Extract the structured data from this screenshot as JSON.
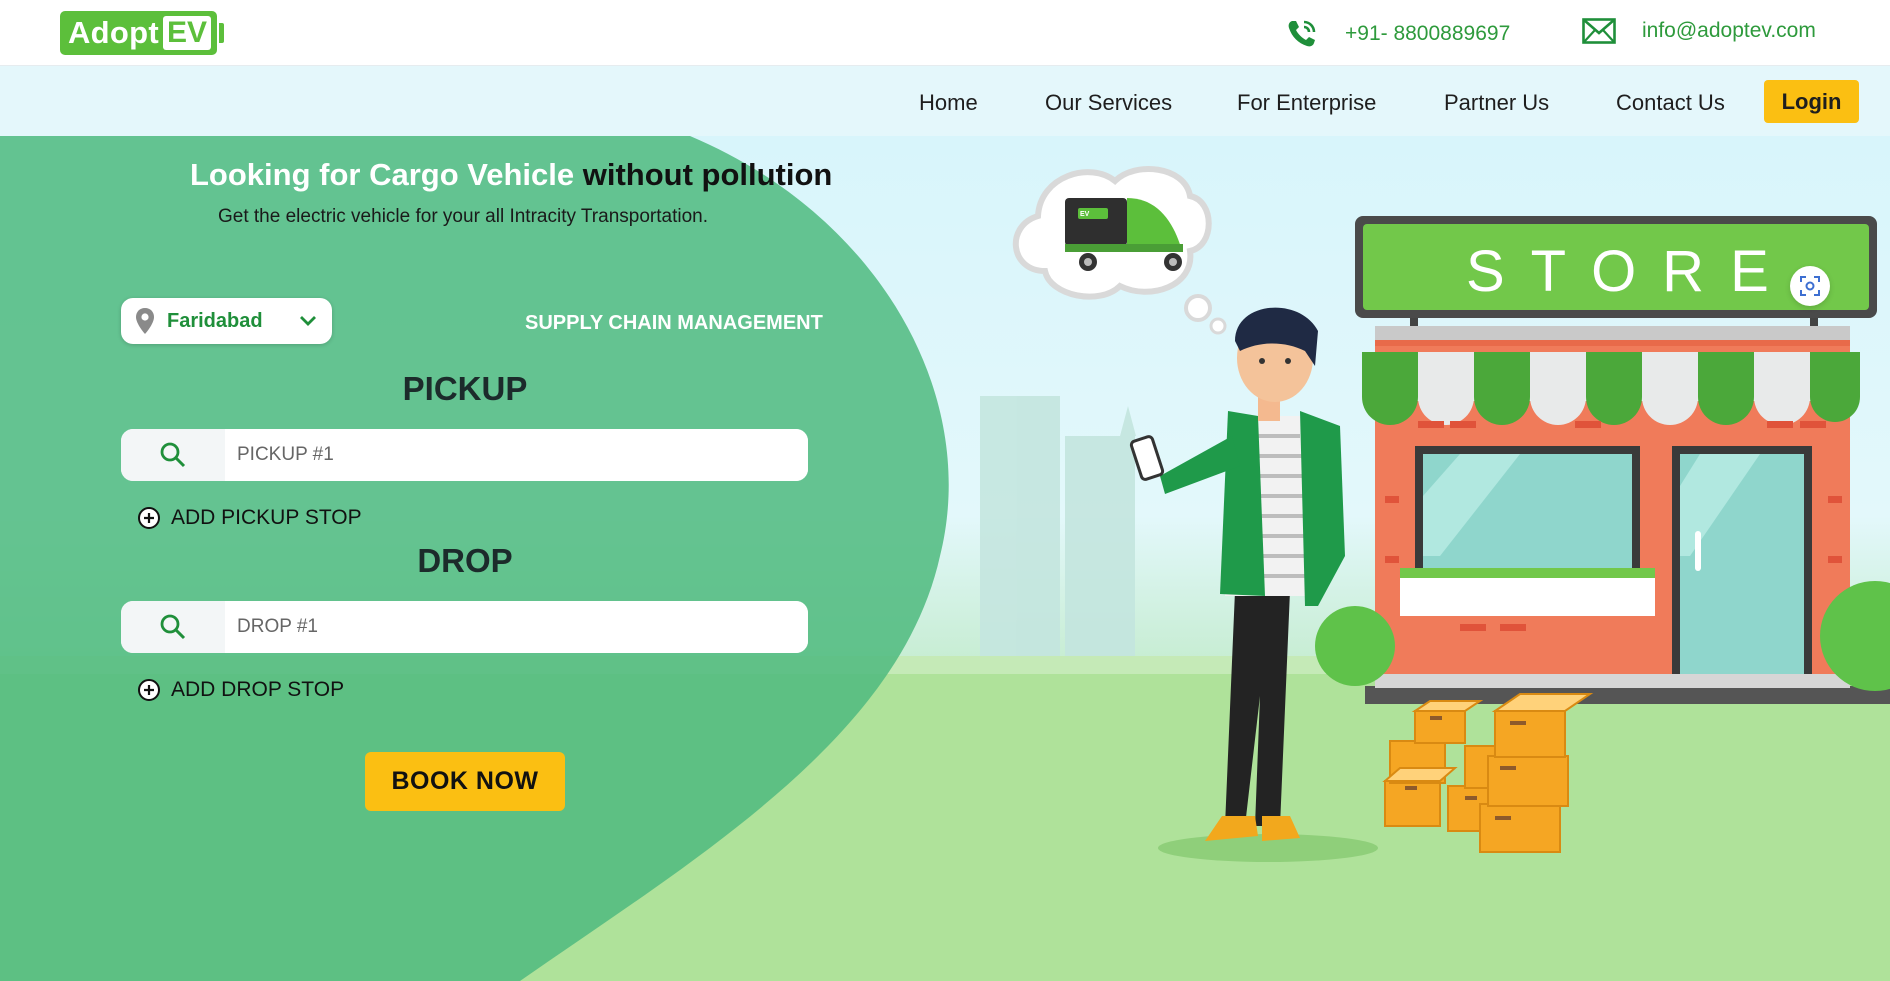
{
  "brand": {
    "adopt": "Adopt",
    "ev": "EV"
  },
  "contact": {
    "phone": "+91- 8800889697",
    "email": "info@adoptev.com"
  },
  "nav": {
    "items": [
      "Home",
      "Our Services",
      "For Enterprise",
      "Partner Us",
      "Contact Us"
    ],
    "login": "Login"
  },
  "hero": {
    "headline_light": "Looking for Cargo Vehicle",
    "headline_dark": "without pollution",
    "subline": "Get the electric vehicle for your all Intracity Transportation.",
    "city": "Faridabad",
    "tab": "SUPPLY CHAIN MANAGEMENT",
    "pickup": {
      "title": "PICKUP",
      "placeholder": "PICKUP #1",
      "add": "ADD PICKUP STOP"
    },
    "drop": {
      "title": "DROP",
      "placeholder": "DROP #1",
      "add": "ADD DROP STOP"
    },
    "book": "BOOK NOW",
    "store_sign": "STORE"
  },
  "colors": {
    "brand_green": "#5cbf3b",
    "accent_yellow": "#fbbf12",
    "form_green": "#4fba7f"
  },
  "icons": [
    "phone-icon",
    "mail-icon",
    "location-pin-icon",
    "chevron-down-icon",
    "search-icon",
    "plus-circle-icon",
    "scan-icon"
  ]
}
